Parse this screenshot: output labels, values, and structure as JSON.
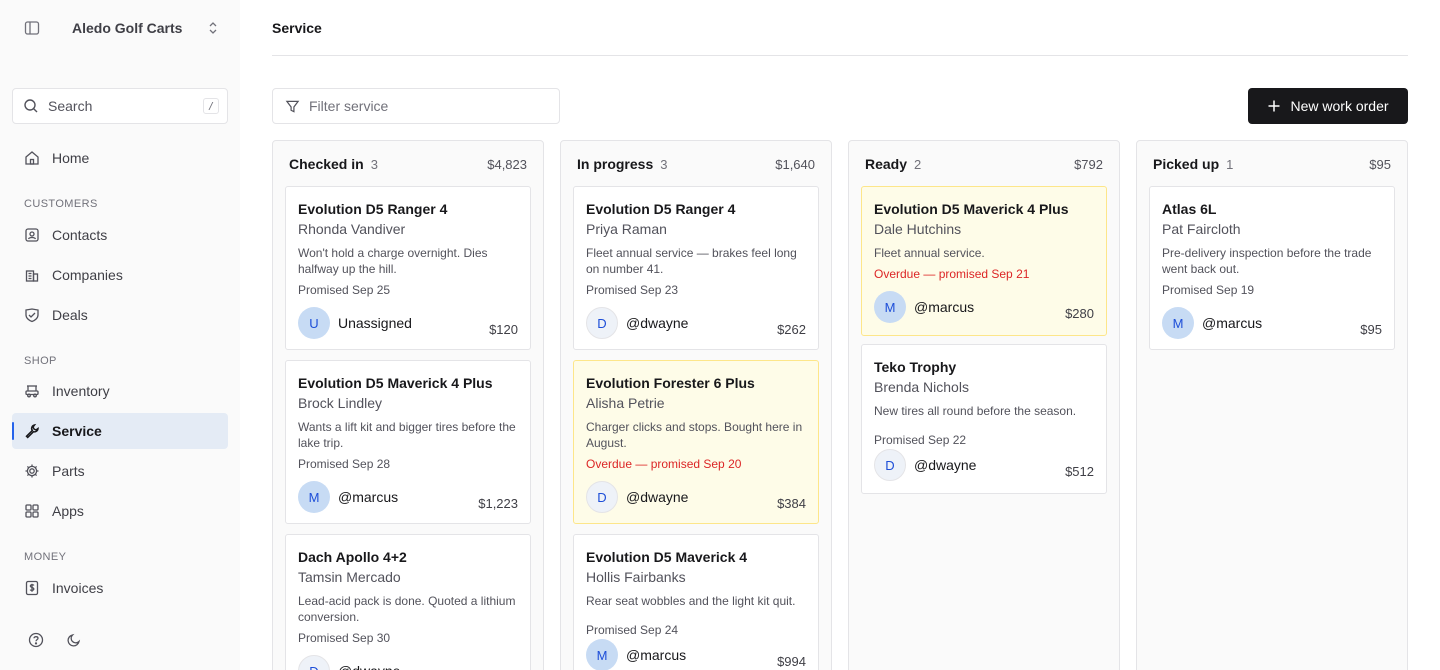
{
  "workspace": {
    "name": "Aledo Golf Carts"
  },
  "search": {
    "placeholder": "Search",
    "shortcut": "/"
  },
  "nav": {
    "home": "Home",
    "sections": {
      "customers": "CUSTOMERS",
      "shop": "SHOP",
      "money": "MONEY"
    },
    "contacts": "Contacts",
    "companies": "Companies",
    "deals": "Deals",
    "inventory": "Inventory",
    "service": "Service",
    "parts": "Parts",
    "apps": "Apps",
    "invoices": "Invoices",
    "active": "service"
  },
  "page": {
    "title": "Service"
  },
  "toolbar": {
    "filter_placeholder": "Filter service",
    "new_label": "New work order"
  },
  "colors": {
    "accent": "#2563eb",
    "overdue_text": "#dc2626",
    "overdue_bg": "#fefce8",
    "button": "#18181b"
  },
  "columns": [
    {
      "name": "Checked in",
      "count": "3",
      "total": "$4,823",
      "cards": [
        {
          "title": "Evolution D5 Ranger 4",
          "customer": "Rhonda Vandiver",
          "desc": "Won't hold a charge overnight. Dies halfway up the hill.",
          "promised": "Promised Sep 25",
          "overdue": "",
          "avatar": "U",
          "assignee": "Unassigned",
          "price": "$120"
        },
        {
          "title": "Evolution D5 Maverick 4 Plus",
          "customer": "Brock Lindley",
          "desc": "Wants a lift kit and bigger tires before the lake trip.",
          "promised": "Promised Sep 28",
          "overdue": "",
          "avatar": "M",
          "assignee": "@marcus",
          "price": "$1,223"
        },
        {
          "title": "Dach Apollo 4+2",
          "customer": "Tamsin Mercado",
          "desc": "Lead-acid pack is done. Quoted a lithium conversion.",
          "promised": "Promised Sep 30",
          "overdue": "",
          "avatar": "D",
          "assignee": "@dwayne",
          "price": ""
        }
      ]
    },
    {
      "name": "In progress",
      "count": "3",
      "total": "$1,640",
      "cards": [
        {
          "title": "Evolution D5 Ranger 4",
          "customer": "Priya Raman",
          "desc": "Fleet annual service — brakes feel long on number 41.",
          "promised": "Promised Sep 23",
          "overdue": "",
          "avatar": "D",
          "assignee": "@dwayne",
          "price": "$262"
        },
        {
          "title": "Evolution Forester 6 Plus",
          "customer": "Alisha Petrie",
          "desc": "Charger clicks and stops. Bought here in August.",
          "promised": "",
          "overdue": "Overdue — promised Sep 20",
          "avatar": "D",
          "assignee": "@dwayne",
          "price": "$384"
        },
        {
          "title": "Evolution D5 Maverick 4",
          "customer": "Hollis Fairbanks",
          "desc": "Rear seat wobbles and the light kit quit.",
          "promised": "Promised Sep 24",
          "overdue": "",
          "avatar": "M",
          "assignee": "@marcus",
          "price": "$994"
        }
      ]
    },
    {
      "name": "Ready",
      "count": "2",
      "total": "$792",
      "cards": [
        {
          "title": "Evolution D5 Maverick 4 Plus",
          "customer": "Dale Hutchins",
          "desc": "Fleet annual service.",
          "promised": "",
          "overdue": "Overdue — promised Sep 21",
          "avatar": "M",
          "assignee": "@marcus",
          "price": "$280"
        },
        {
          "title": "Teko Trophy",
          "customer": "Brenda Nichols",
          "desc": "New tires all round before the season.",
          "promised": "Promised Sep 22",
          "overdue": "",
          "avatar": "D",
          "assignee": "@dwayne",
          "price": "$512"
        }
      ]
    },
    {
      "name": "Picked up",
      "count": "1",
      "total": "$95",
      "cards": [
        {
          "title": "Atlas 6L",
          "customer": "Pat Faircloth",
          "desc": "Pre-delivery inspection before the trade went back out.",
          "promised": "Promised Sep 19",
          "overdue": "",
          "avatar": "M",
          "assignee": "@marcus",
          "price": "$95"
        }
      ]
    }
  ]
}
